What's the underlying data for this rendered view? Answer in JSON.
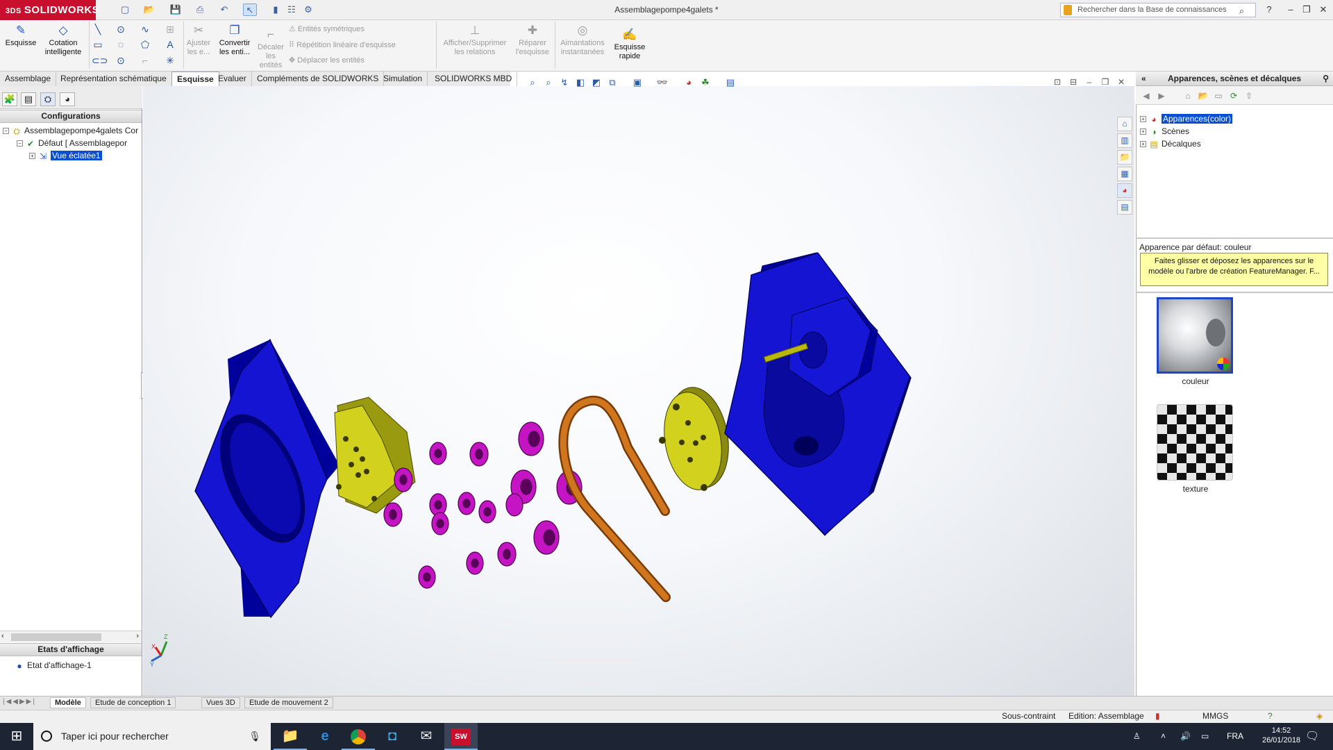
{
  "app": {
    "brand": "SOLIDWORKS",
    "window_title": "Assemblagepompe4galets *"
  },
  "search": {
    "placeholder": "Rechercher dans la Base de connaissances"
  },
  "ribbon": {
    "sketch": "Esquisse",
    "smart_dim_1": "Cotation",
    "smart_dim_2": "intelligente",
    "trim_1": "Ajuster",
    "trim_2": "les e...",
    "convert_1": "Convertir",
    "convert_2": "les enti...",
    "offset_1": "Décaler",
    "offset_2": "les",
    "offset_3": "entités",
    "mirror": "Entités symétriques",
    "linear_pattern": "Répétition linéaire d'esquisse",
    "move": "Déplacer les entités",
    "relations_1": "Afficher/Supprimer",
    "relations_2": "les relations",
    "repair_1": "Réparer",
    "repair_2": "l'esquisse",
    "snaps_1": "Aimantations",
    "snaps_2": "instantanées",
    "quick_1": "Esquisse",
    "quick_2": "rapide"
  },
  "tabs": [
    "Assemblage",
    "Représentation schématique",
    "Esquisse",
    "Evaluer",
    "Compléments de SOLIDWORKS",
    "Simulation",
    "SOLIDWORKS MBD"
  ],
  "active_tab": "Esquisse",
  "configmanager": {
    "header": "Configurations",
    "root": "Assemblagepompe4galets Cor",
    "default": "Défaut [ Assemblagepor",
    "exploded": "Vue éclatée1"
  },
  "display_states": {
    "header": "Etats d'affichage",
    "item": "Etat d'affichage-1"
  },
  "taskpane": {
    "title": "Apparences, scènes et décalques",
    "tree": [
      "Apparences(color)",
      "Scènes",
      "Décalques"
    ],
    "default_label": "Apparence par défaut: couleur",
    "tooltip": "Faites glisser et déposez les apparences sur le modèle ou l'arbre de création FeatureManager. F...",
    "thumbs": [
      "couleur",
      "texture"
    ]
  },
  "bottom_tabs": [
    "Modèle",
    "Etude de conception 1",
    "Vues 3D",
    "Etude de mouvement 2"
  ],
  "status": {
    "constraint": "Sous-contraint",
    "mode": "Edition: Assemblage",
    "units": "MMGS"
  },
  "taskbar": {
    "search": "Taper ici pour rechercher",
    "lang": "FRA",
    "time": "14:52",
    "date": "26/01/2018"
  },
  "colors": {
    "brand": "#c8102e",
    "selection": "#0a4fd0",
    "part_blue": "#1010c8",
    "part_yellow": "#c8c81a",
    "roller_magenta": "#c414c4",
    "tube_copper": "#c0661a"
  }
}
